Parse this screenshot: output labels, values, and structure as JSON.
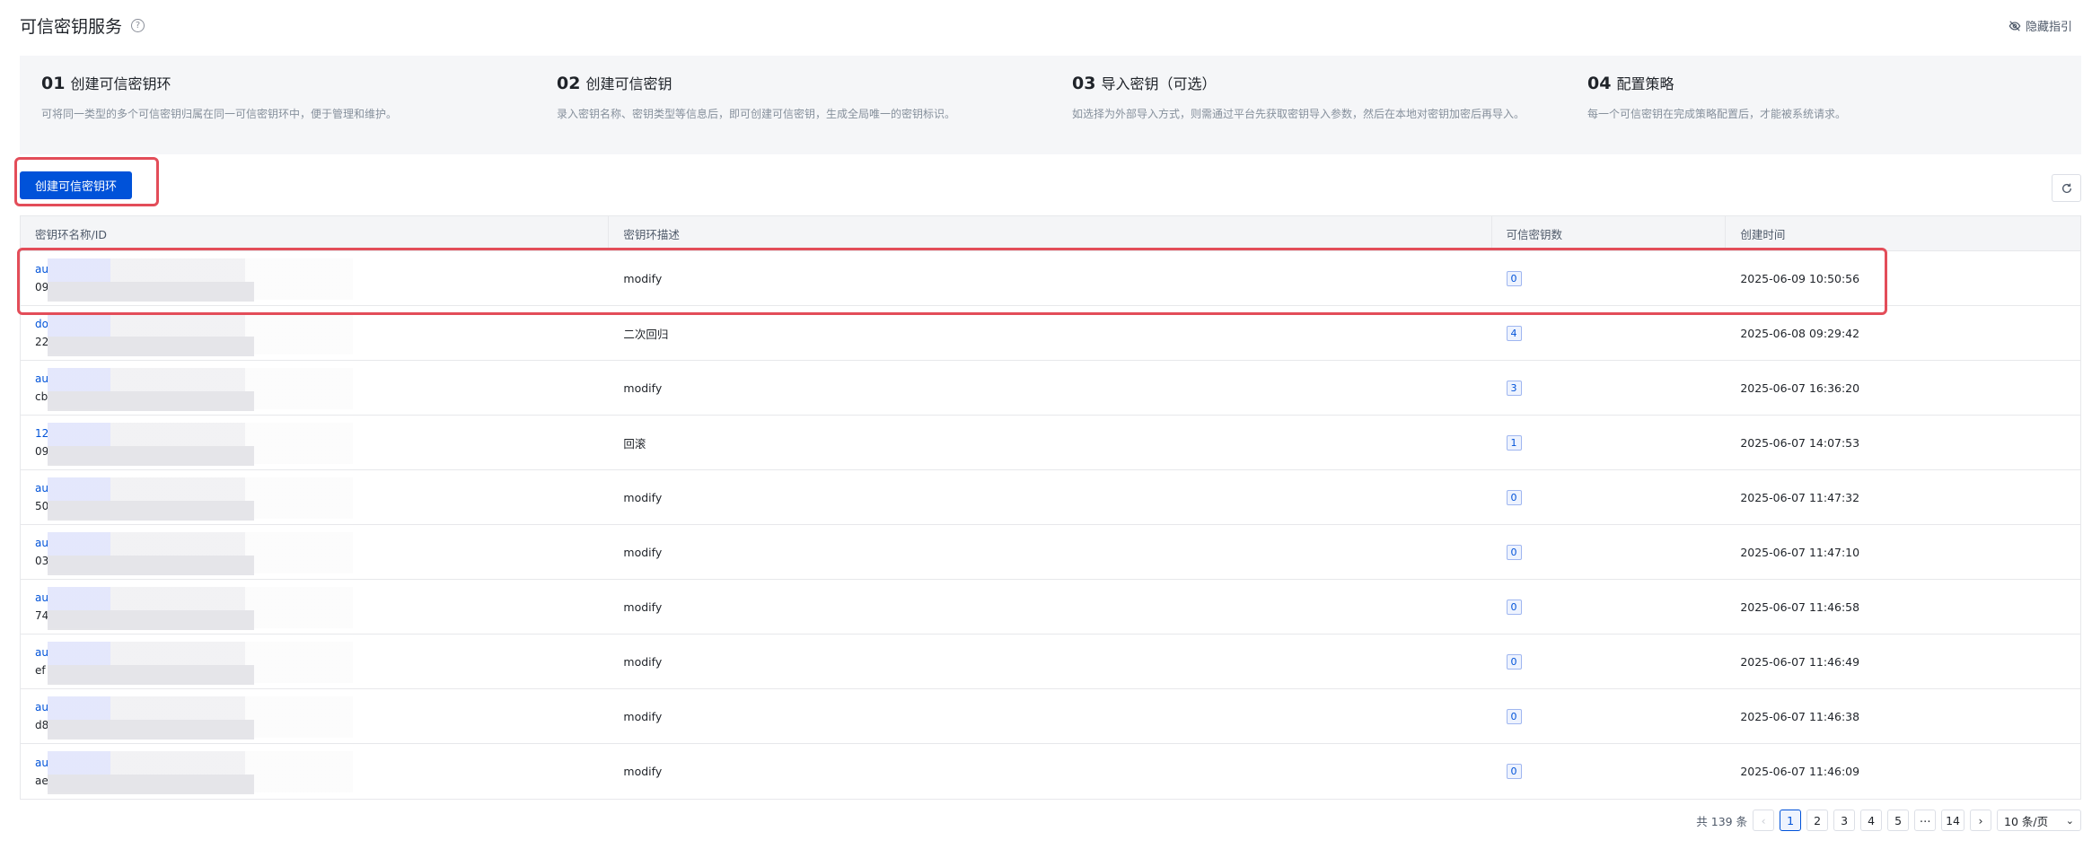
{
  "header": {
    "title": "可信密钥服务",
    "hide_guide": "隐藏指引"
  },
  "guide": {
    "steps": [
      {
        "num": "01",
        "title": "创建可信密钥环",
        "desc": "可将同一类型的多个可信密钥归属在同一可信密钥环中，便于管理和维护。"
      },
      {
        "num": "02",
        "title": "创建可信密钥",
        "desc": "录入密钥名称、密钥类型等信息后，即可创建可信密钥，生成全局唯一的密钥标识。"
      },
      {
        "num": "03",
        "title": "导入密钥（可选）",
        "desc": "如选择为外部导入方式，则需通过平台先获取密钥导入参数，然后在本地对密钥加密后再导入。"
      },
      {
        "num": "04",
        "title": "配置策略",
        "desc": "每一个可信密钥在完成策略配置后，才能被系统请求。"
      }
    ]
  },
  "toolbar": {
    "create_label": "创建可信密钥环"
  },
  "table": {
    "columns": [
      "密钥环名称/ID",
      "密钥环描述",
      "可信密钥数",
      "创建时间"
    ],
    "rows": [
      {
        "name": "au",
        "id": "09",
        "desc": "modify",
        "count": "0",
        "created": "2025-06-09 10:50:56"
      },
      {
        "name": "do",
        "id": "22",
        "desc": "二次回归",
        "count": "4",
        "created": "2025-06-08 09:29:42"
      },
      {
        "name": "au",
        "id": "cb",
        "desc": "modify",
        "count": "3",
        "created": "2025-06-07 16:36:20"
      },
      {
        "name": "12",
        "id": "09",
        "desc": "回滚",
        "count": "1",
        "created": "2025-06-07 14:07:53"
      },
      {
        "name": "au",
        "id": "50",
        "desc": "modify",
        "count": "0",
        "created": "2025-06-07 11:47:32"
      },
      {
        "name": "au",
        "id": "03",
        "desc": "modify",
        "count": "0",
        "created": "2025-06-07 11:47:10"
      },
      {
        "name": "au",
        "id": "74",
        "desc": "modify",
        "count": "0",
        "created": "2025-06-07 11:46:58"
      },
      {
        "name": "au",
        "id": "ef",
        "desc": "modify",
        "count": "0",
        "created": "2025-06-07 11:46:49"
      },
      {
        "name": "au",
        "id": "d8",
        "desc": "modify",
        "count": "0",
        "created": "2025-06-07 11:46:38"
      },
      {
        "name": "au",
        "id": "ae",
        "desc": "modify",
        "count": "0",
        "created": "2025-06-07 11:46:09"
      }
    ]
  },
  "pagination": {
    "total": "共 139 条",
    "pages": [
      "1",
      "2",
      "3",
      "4",
      "5",
      "⋯",
      "14"
    ],
    "current": "1",
    "page_size": "10 条/页"
  },
  "colors": {
    "primary": "#0052d9",
    "highlight": "#e34d59"
  }
}
